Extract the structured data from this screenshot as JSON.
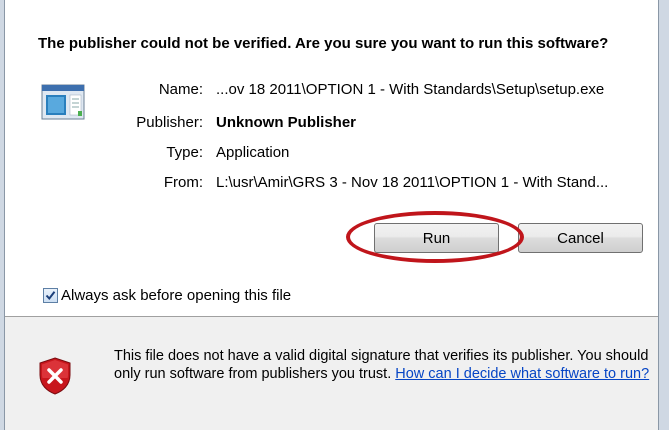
{
  "dialog": {
    "question": "The publisher could not be verified.  Are you sure you want to run this software?",
    "fields": {
      "name_label": "Name:",
      "name_value": "...ov 18 2011\\OPTION 1 - With Standards\\Setup\\setup.exe",
      "publisher_label": "Publisher:",
      "publisher_value": "Unknown Publisher",
      "type_label": "Type:",
      "type_value": "Application",
      "from_label": "From:",
      "from_value": "L:\\usr\\Amir\\GRS 3 - Nov 18 2011\\OPTION 1 - With Stand..."
    },
    "buttons": {
      "run_label": "Run",
      "cancel_label": "Cancel"
    },
    "checkbox": {
      "label": "Always ask before opening this file",
      "checked": true
    },
    "warning": {
      "text": "This file does not have a valid digital signature that verifies its publisher. You should only run software from publishers you trust.",
      "link_text": "How can I decide what software to run?"
    },
    "colors": {
      "highlight_circle": "#c0151b",
      "link": "#0645c5",
      "shield_red": "#c8161d"
    },
    "icons": {
      "application": "application-icon",
      "shield": "shield-warning-icon",
      "check": "checkmark-icon"
    }
  }
}
